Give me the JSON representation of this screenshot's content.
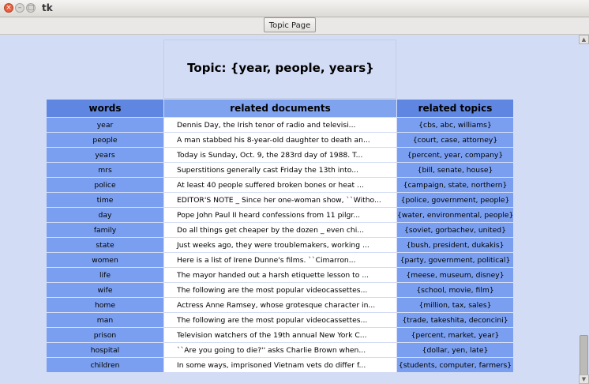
{
  "window": {
    "title": "tk",
    "close_symbol": "×",
    "min_symbol": "–",
    "max_symbol": "□"
  },
  "toolbar": {
    "topic_page_label": "Topic Page"
  },
  "heading": "Topic: {year, people, years}",
  "columns": {
    "words": "words",
    "docs": "related documents",
    "topics": "related topics"
  },
  "rows": [
    {
      "word": "year",
      "doc": "Dennis Day, the Irish tenor of radio and televisi...",
      "topics": "{cbs, abc, williams}"
    },
    {
      "word": "people",
      "doc": "A man stabbed his 8-year-old daughter to death an...",
      "topics": "{court, case, attorney}"
    },
    {
      "word": "years",
      "doc": "Today is Sunday, Oct. 9, the 283rd day of 1988. T...",
      "topics": "{percent, year, company}"
    },
    {
      "word": "mrs",
      "doc": "Superstitions generally cast Friday the 13th into...",
      "topics": "{bill, senate, house}"
    },
    {
      "word": "police",
      "doc": "At least 40 people suffered broken bones or heat ...",
      "topics": "{campaign, state, northern}"
    },
    {
      "word": "time",
      "doc": "EDITOR'S NOTE _ Since her one-woman show, ``Witho...",
      "topics": "{police, government, people}"
    },
    {
      "word": "day",
      "doc": "Pope John Paul II heard confessions from 11 pilgr...",
      "topics": "{water, environmental, people}"
    },
    {
      "word": "family",
      "doc": "Do all things get cheaper by the dozen _ even chi...",
      "topics": "{soviet, gorbachev, united}"
    },
    {
      "word": "state",
      "doc": "Just weeks ago, they were troublemakers, working ...",
      "topics": "{bush, president, dukakis}"
    },
    {
      "word": "women",
      "doc": "Here is a list of Irene Dunne's films. ``Cimarron...",
      "topics": "{party, government, political}"
    },
    {
      "word": "life",
      "doc": "The mayor handed out a harsh etiquette lesson to ...",
      "topics": "{meese, museum, disney}"
    },
    {
      "word": "wife",
      "doc": "The following are the most popular videocassettes...",
      "topics": "{school, movie, film}"
    },
    {
      "word": "home",
      "doc": "Actress Anne Ramsey, whose grotesque character in...",
      "topics": "{million, tax, sales}"
    },
    {
      "word": "man",
      "doc": "The following are the most popular videocassettes...",
      "topics": "{trade, takeshita, deconcini}"
    },
    {
      "word": "prison",
      "doc": "Television watchers of the 19th annual New York C...",
      "topics": "{percent, market, year}"
    },
    {
      "word": "hospital",
      "doc": "``Are you going to die?'' asks Charlie Brown when...",
      "topics": "{dollar, yen, late}"
    },
    {
      "word": "children",
      "doc": "In some ways, imprisoned Vietnam vets do differ f...",
      "topics": "{students, computer, farmers}"
    }
  ]
}
